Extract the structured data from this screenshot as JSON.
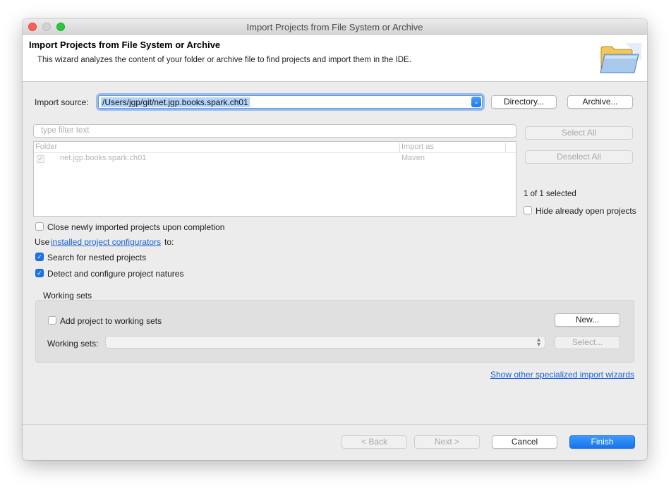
{
  "window": {
    "title": "Import Projects from File System or Archive"
  },
  "header": {
    "title": "Import Projects from File System or Archive",
    "description": "This wizard analyzes the content of your folder or archive file to find projects and import them in the IDE.",
    "icon": "folder-open-icon"
  },
  "source": {
    "label": "Import source:",
    "value": "/Users/jgp/git/net.jgp.books.spark.ch01",
    "directory_button": "Directory...",
    "archive_button": "Archive..."
  },
  "filter": {
    "placeholder": "type filter text"
  },
  "table": {
    "columns": [
      "Folder",
      "Import as"
    ],
    "rows": [
      {
        "checked": true,
        "folder": "net.jgp.books.spark.ch01",
        "import_as": "Maven"
      }
    ]
  },
  "side": {
    "select_all": "Select All",
    "deselect_all": "Deselect All",
    "selected_count": "1 of 1 selected",
    "hide_open": "Hide already open projects"
  },
  "options": {
    "close_imported": "Close newly imported projects upon completion",
    "use_prefix": "Use",
    "configurators_link": "installed project configurators",
    "use_suffix": "to:",
    "search_nested": "Search for nested projects",
    "detect_natures": "Detect and configure project natures"
  },
  "working_sets": {
    "group_label": "Working sets",
    "add_label": "Add project to working sets",
    "new_button": "New...",
    "sets_label": "Working sets:",
    "select_button": "Select..."
  },
  "other_wizards_link": "Show other specialized import wizards",
  "footer": {
    "back": "< Back",
    "next": "Next >",
    "cancel": "Cancel",
    "finish": "Finish"
  },
  "colors": {
    "accent": "#1a73e8",
    "link": "#1a61d6",
    "close": "#fc5f57",
    "maximize": "#2bc840"
  }
}
